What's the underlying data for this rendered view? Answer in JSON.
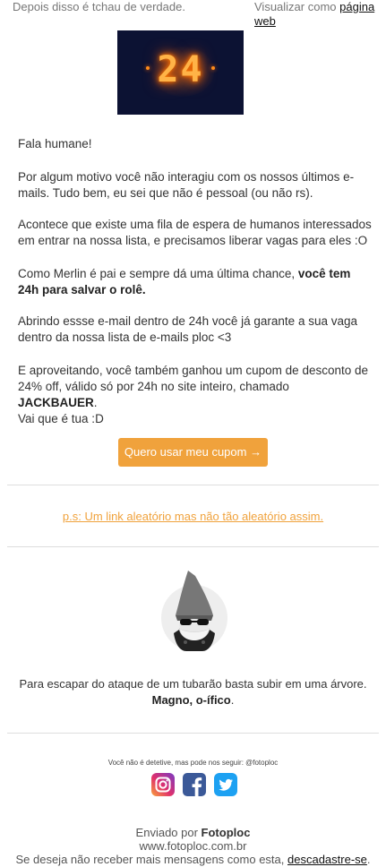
{
  "preheader": {
    "left_text": "Depois disso é tchau de verdade.",
    "view_prefix": "Visualizar como ",
    "view_link": "página web"
  },
  "hero": {
    "digits": "24"
  },
  "content": {
    "greeting": "Fala humane!",
    "p1": "Por algum motivo você não interagiu com os nossos últimos e-mails. Tudo bem, eu sei que não é pessoal (ou não rs).",
    "p2": "Acontece que existe uma fila de espera de humanos interessados em entrar na nossa lista, e precisamos liberar vagas para eles :O",
    "p3_prefix": "Como Merlin é pai e sempre dá uma última chance, ",
    "p3_bold": "você tem 24h para salvar o rolê.",
    "p4": "Abrindo essse e-mail dentro de 24h você já garante a sua vaga dentro da nossa lista de e-mails ploc <3",
    "p5_prefix": "E aproveitando, você também ganhou um cupom de desconto de 24% off, válido só por 24h no site inteiro, chamado ",
    "p5_bold": "JACKBAUER",
    "p5_suffix": ".",
    "p6": "Vai que é tua :D"
  },
  "cta": {
    "label": "Quero usar meu cupom →",
    "color": "#f0a23c"
  },
  "ps": {
    "link": "p.s: Um link aleatório mas não tão aleatório assim."
  },
  "signature": {
    "quote": "Para escapar do ataque de um tubarão basta subir em uma árvore.",
    "author": "Magno, o-ífico",
    "author_suffix": "."
  },
  "social": {
    "note": "Você não é detetive, mas pode nos seguir: @fotoploc",
    "icons": [
      "instagram-icon",
      "facebook-icon",
      "twitter-icon"
    ]
  },
  "footer": {
    "sent_prefix": "Enviado por ",
    "sent_brand": "Fotoploc",
    "url": "www.fotoploc.com.br",
    "unsub_prefix": "Se deseja não receber mais mensagens como esta, ",
    "unsub_link": "descadastre-se",
    "unsub_suffix": "."
  }
}
